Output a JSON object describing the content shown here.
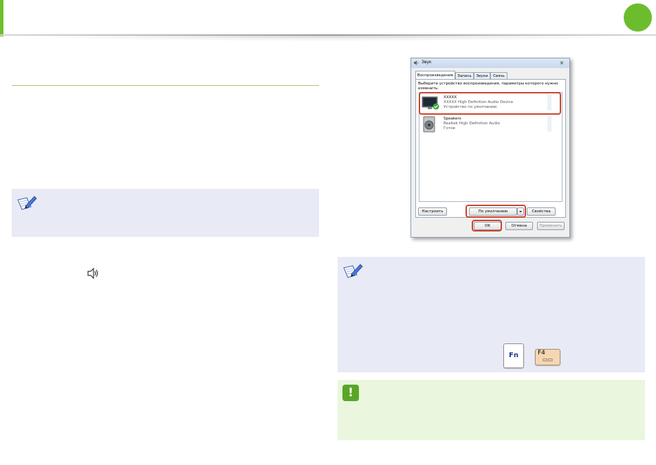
{
  "colors": {
    "accent_green": "#6bbd2e",
    "note_background": "#e8eaf6",
    "warning_background": "#eaf6dd",
    "highlight_red": "#c9442c"
  },
  "icons": {
    "note": "pencil-note-icon",
    "warning": "exclamation-icon",
    "volume": "speaker-icon",
    "device_monitor": "monitor-icon",
    "device_speakers": "speaker-device-icon",
    "default_check": "green-check-icon"
  },
  "dialog": {
    "title": "Звук",
    "close_glyph": "×",
    "tabs": [
      {
        "label": "Воспроизведение"
      },
      {
        "label": "Запись"
      },
      {
        "label": "Звуки"
      },
      {
        "label": "Связь"
      }
    ],
    "instruction": "Выберите устройство воспроизведения, параметры которого нужно изменить:",
    "devices": [
      {
        "name": "XXXXX",
        "driver": "XXXXX High Definition Audio Device",
        "status": "Устройство по умолчанию"
      },
      {
        "name": "Speakers",
        "driver": "Realtek High Definition Audio",
        "status": "Готов"
      }
    ],
    "configure_button": "Настроить",
    "default_button": "По умолчанию",
    "properties_button": "Свойства",
    "ok_button": "OK",
    "cancel_button": "Отмена",
    "apply_button": "Применить"
  },
  "keys": {
    "fn": "Fn",
    "f4": "F4",
    "f4_glyph": "▭▭"
  }
}
